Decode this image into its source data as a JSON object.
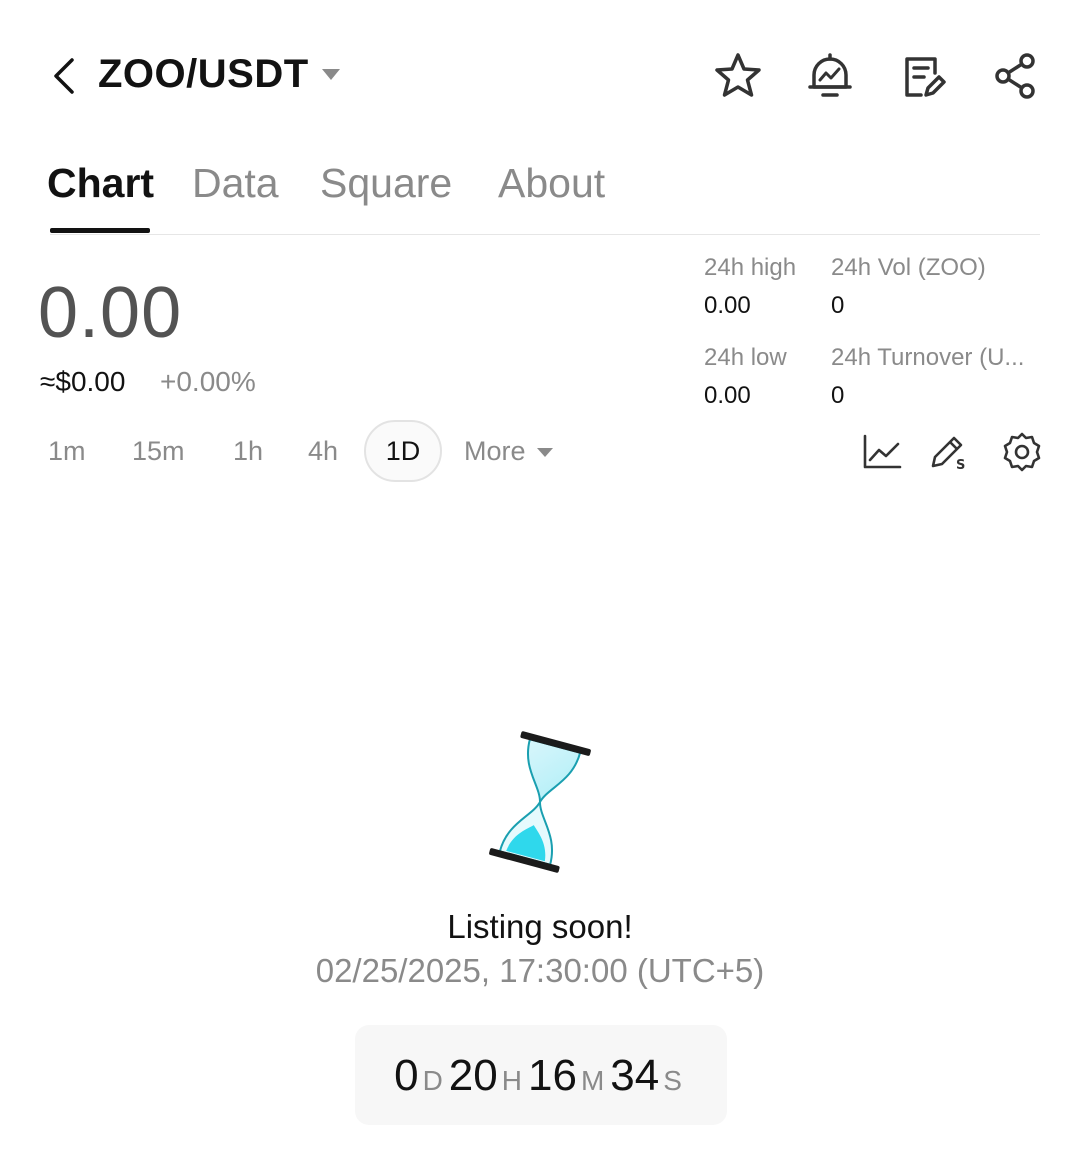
{
  "header": {
    "pair": "ZOO/USDT",
    "icons": [
      "back-chevron-icon",
      "caret-down-icon",
      "star-icon",
      "price-alert-icon",
      "notes-icon",
      "share-icon"
    ]
  },
  "tabs": [
    {
      "label": "Chart",
      "active": true
    },
    {
      "label": "Data",
      "active": false
    },
    {
      "label": "Square",
      "active": false
    },
    {
      "label": "About",
      "active": false
    }
  ],
  "ticker": {
    "price": "0.00",
    "approx_usd": "≈$0.00",
    "change_pct": "+0.00%",
    "stats": {
      "high_label": "24h high",
      "high_value": "0.00",
      "vol_label": "24h Vol (ZOO)",
      "vol_value": "0",
      "low_label": "24h low",
      "low_value": "0.00",
      "turnover_label": "24h Turnover (U...",
      "turnover_value": "0"
    }
  },
  "timeframes": {
    "items": [
      "1m",
      "15m",
      "1h",
      "4h"
    ],
    "active": "1D",
    "more_label": "More"
  },
  "tools": [
    "indicator-chart-icon",
    "draw-tool-icon",
    "settings-gear-icon"
  ],
  "listing": {
    "title": "Listing soon!",
    "datetime": "02/25/2025, 17:30:00 (UTC+5)",
    "countdown": {
      "days": "0",
      "days_unit": "D",
      "hours": "20",
      "hours_unit": "H",
      "minutes": "16",
      "minutes_unit": "M",
      "seconds": "34",
      "seconds_unit": "S"
    }
  },
  "colors": {
    "text_primary": "#121212",
    "text_secondary": "#8a8a8a",
    "price_gray": "#535353",
    "hourglass_sand": "#2fd8ec"
  }
}
